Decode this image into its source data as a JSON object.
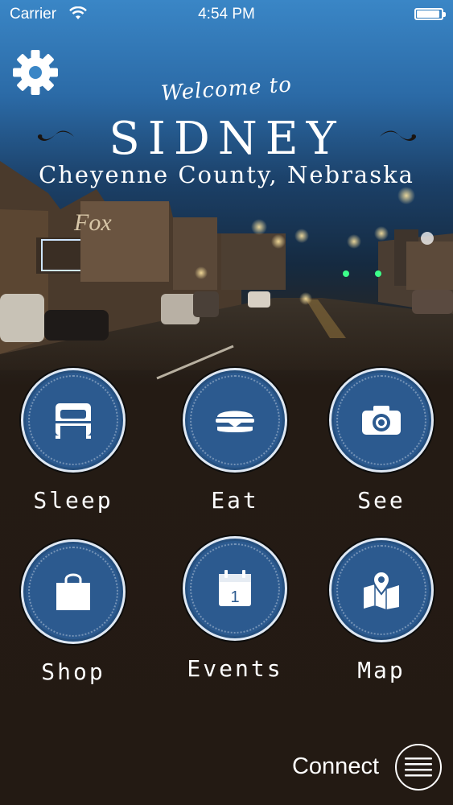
{
  "status_bar": {
    "carrier": "Carrier",
    "time": "4:54 PM",
    "battery_level": 1.0
  },
  "header": {
    "settings_icon": "gear-icon",
    "welcome": "Welcome to",
    "title": "SIDNEY",
    "subtitle": "Cheyenne County, Nebraska"
  },
  "menu": [
    {
      "label": "Sleep",
      "icon": "bed-icon"
    },
    {
      "label": "Eat",
      "icon": "burger-icon"
    },
    {
      "label": "See",
      "icon": "camera-icon"
    },
    {
      "label": "Shop",
      "icon": "shopping-bag-icon"
    },
    {
      "label": "Events",
      "icon": "calendar-icon",
      "calendar_day": "1"
    },
    {
      "label": "Map",
      "icon": "map-icon"
    }
  ],
  "footer": {
    "connect_label": "Connect",
    "menu_icon": "hamburger-icon"
  },
  "colors": {
    "tile_blue": "#2c5a8f",
    "sky_blue": "#3a86c6",
    "ground_brown": "#231a13"
  }
}
